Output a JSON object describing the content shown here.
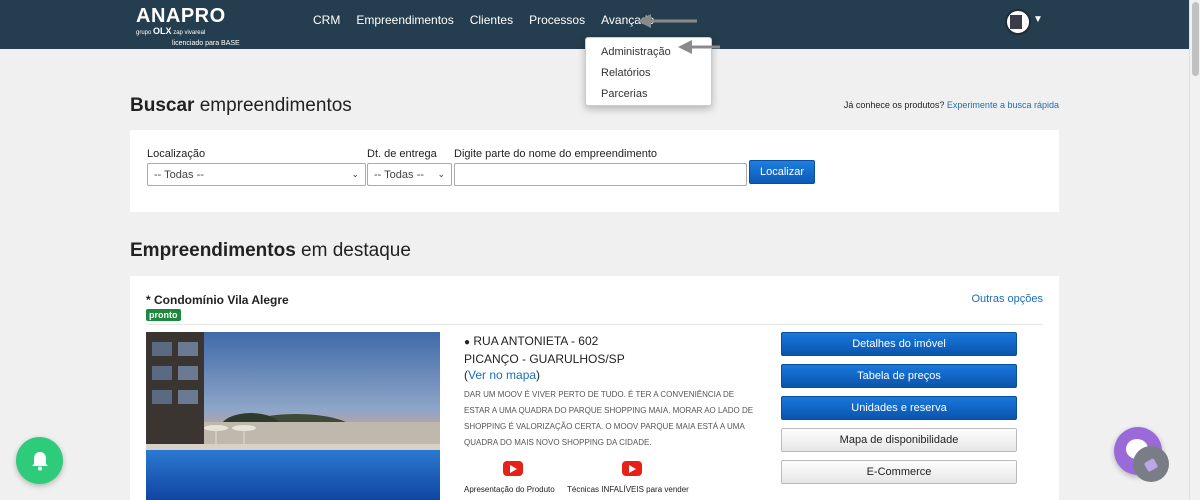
{
  "header": {
    "logo": "ANAPRO",
    "logo_group_prefix": "grupo",
    "logo_group_name": "OLX",
    "logo_group_suffix": "zap  vivareal",
    "licensed": "licenciado para BASE",
    "nav": [
      "CRM",
      "Empreendimentos",
      "Clientes",
      "Processos",
      "Avançado"
    ],
    "bar_color": "#243d4f"
  },
  "dropdown": {
    "items": [
      "Administração",
      "Relatórios",
      "Parcerias"
    ]
  },
  "busca": {
    "title_bold": "Buscar",
    "title_rest": " empreendimentos",
    "hint": "Já conhece os produtos? ",
    "hint_link": "Experimente a busca rápida",
    "location_label": "Localização",
    "location_value": "-- Todas --",
    "delivery_label": "Dt. de entrega",
    "delivery_value": "-- Todas --",
    "name_label": "Digite parte do nome do empreendimento",
    "name_value": "",
    "search_button": "Localizar"
  },
  "destaque": {
    "title_bold": "Empreendimentos",
    "title_rest": " em destaque",
    "property": {
      "name": "* Condomínio Vila Alegre",
      "badge": "pronto",
      "other_options": "Outras opções",
      "address_line1": "RUA ANTONIETA - 602",
      "address_line2": "PICANÇO - GUARULHOS/SP",
      "map_open": "(",
      "map_link": "Ver no mapa",
      "map_close": ")",
      "description": "DAR UM MOOV É VIVER PERTO DE TUDO. É TER A CONVENIÊNCIA DE ESTAR A UMA QUADRA DO PARQUE SHOPPING MAIA. MORAR AO LADO DE SHOPPING É VALORIZAÇÃO CERTA. O MOOV PARQUE MAIA ESTÁ A UMA QUADRA DO MAIS NOVO SHOPPING DA CIDADE.",
      "videos": [
        "Apresentação do Produto",
        "Técnicas INFALÍVEIS para vender"
      ],
      "actions": [
        {
          "label": "Detalhes do imóvel",
          "style": "blue"
        },
        {
          "label": "Tabela de preços",
          "style": "blue"
        },
        {
          "label": "Unidades e reserva",
          "style": "blue"
        },
        {
          "label": "Mapa de disponibilidade",
          "style": "gray"
        },
        {
          "label": "E-Commerce",
          "style": "gray"
        }
      ]
    }
  },
  "colors": {
    "primary_blue": "#0b5bb5",
    "link": "#1a6fb8",
    "badge_green": "#1b8a3c",
    "bell_green": "#2ecc7a",
    "chat_purple": "#9a6bd8"
  }
}
